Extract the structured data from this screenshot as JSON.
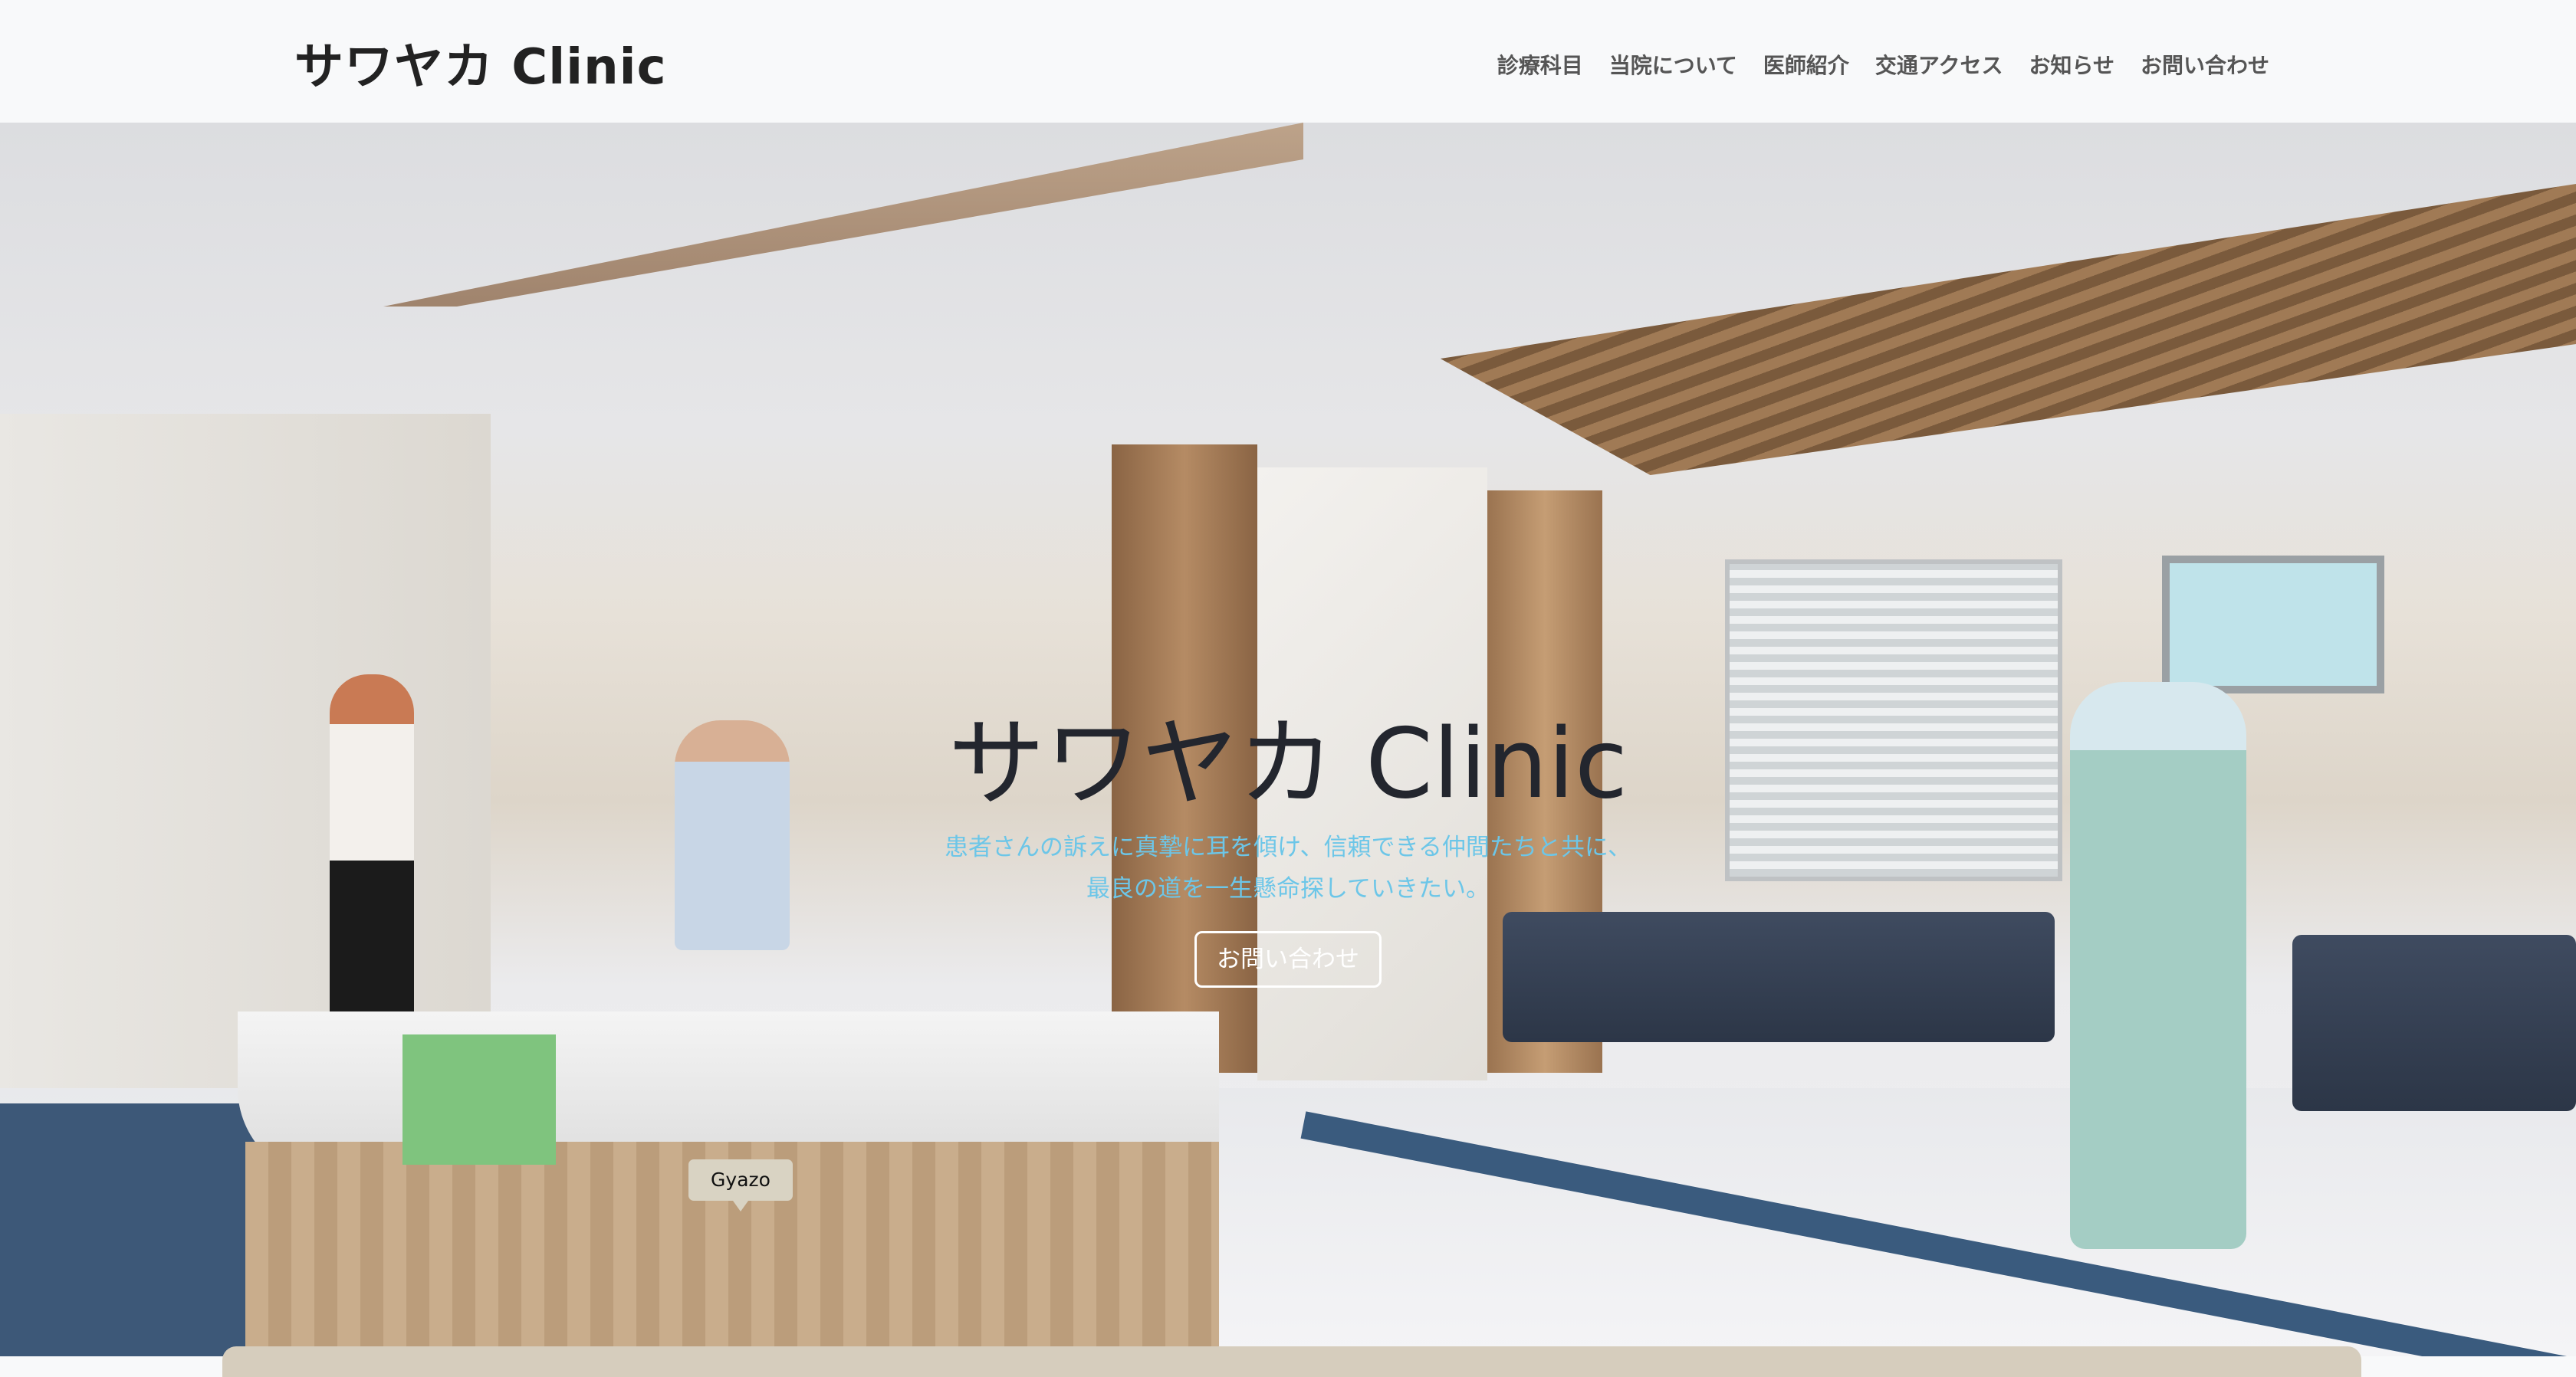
{
  "header": {
    "logo": "サワヤカ Clinic",
    "nav": [
      "診療科目",
      "当院について",
      "医師紹介",
      "交通アクセス",
      "お知らせ",
      "お問い合わせ"
    ]
  },
  "hero": {
    "title": "サワヤカ Clinic",
    "subtitle_lines": [
      "患者さんの訴えに真摯に耳を傾け、信頼できる仲間たちと共に、",
      "最良の道を一生懸命探していきたい。"
    ],
    "button": "お問い合わせ"
  },
  "tooltip": {
    "label": "Gyazo"
  },
  "colors": {
    "accent": "#6cc6e8",
    "title": "#23262e",
    "nav": "#555555"
  }
}
